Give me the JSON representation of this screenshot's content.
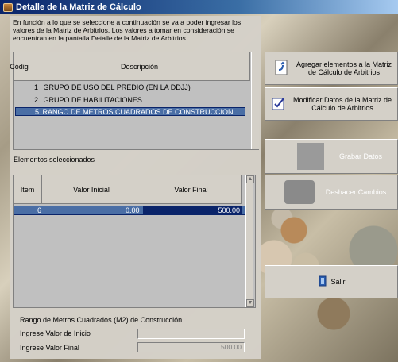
{
  "window": {
    "title": "Detalle de la Matriz de Cálculo"
  },
  "intro_text": "En función a lo que se seleccione a continuación se va a poder ingresar los valores de la Matriz de Arbitrios. Los valores a tomar en consideración se encuentran en la pantalla Detalle de la Matriz de Arbitrios.",
  "upper_grid": {
    "columns": [
      "Código",
      "Descripción"
    ],
    "rows": [
      {
        "code": "1",
        "description": "GRUPO DE USO DEL PREDIO (EN LA DDJJ)"
      },
      {
        "code": "2",
        "description": "GRUPO DE HABILITACIONES"
      },
      {
        "code": "5",
        "description": "RANGO DE METROS CUADRADOS DE CONSTRUCCION"
      }
    ],
    "selected_code": "5"
  },
  "selected_label": "Elementos seleccionados",
  "lower_grid": {
    "columns": [
      "Item",
      "Valor Inicial",
      "Valor Final"
    ],
    "rows": [
      {
        "item": "6",
        "valor_inicial": "0.00",
        "valor_final": "500.00"
      }
    ]
  },
  "range_section": {
    "title": "Rango de Metros Cuadrados (M2) de Construcción",
    "start_label": "Ingrese Valor de Inicio",
    "start_value": "",
    "end_label": "Ingrese Valor Final",
    "end_value": "500.00"
  },
  "buttons": {
    "add": "Agregar elementos a la Matriz de Cálculo de Arbitrios",
    "modify": "Modificar Datos de la Matriz de Cálculo de Arbitrios",
    "save": "Grabar Datos",
    "undo": "Deshacer Cambios",
    "exit": "Salir"
  },
  "icons": {
    "add": "add-document-icon",
    "modify": "edit-check-icon",
    "exit": "exit-door-icon"
  }
}
